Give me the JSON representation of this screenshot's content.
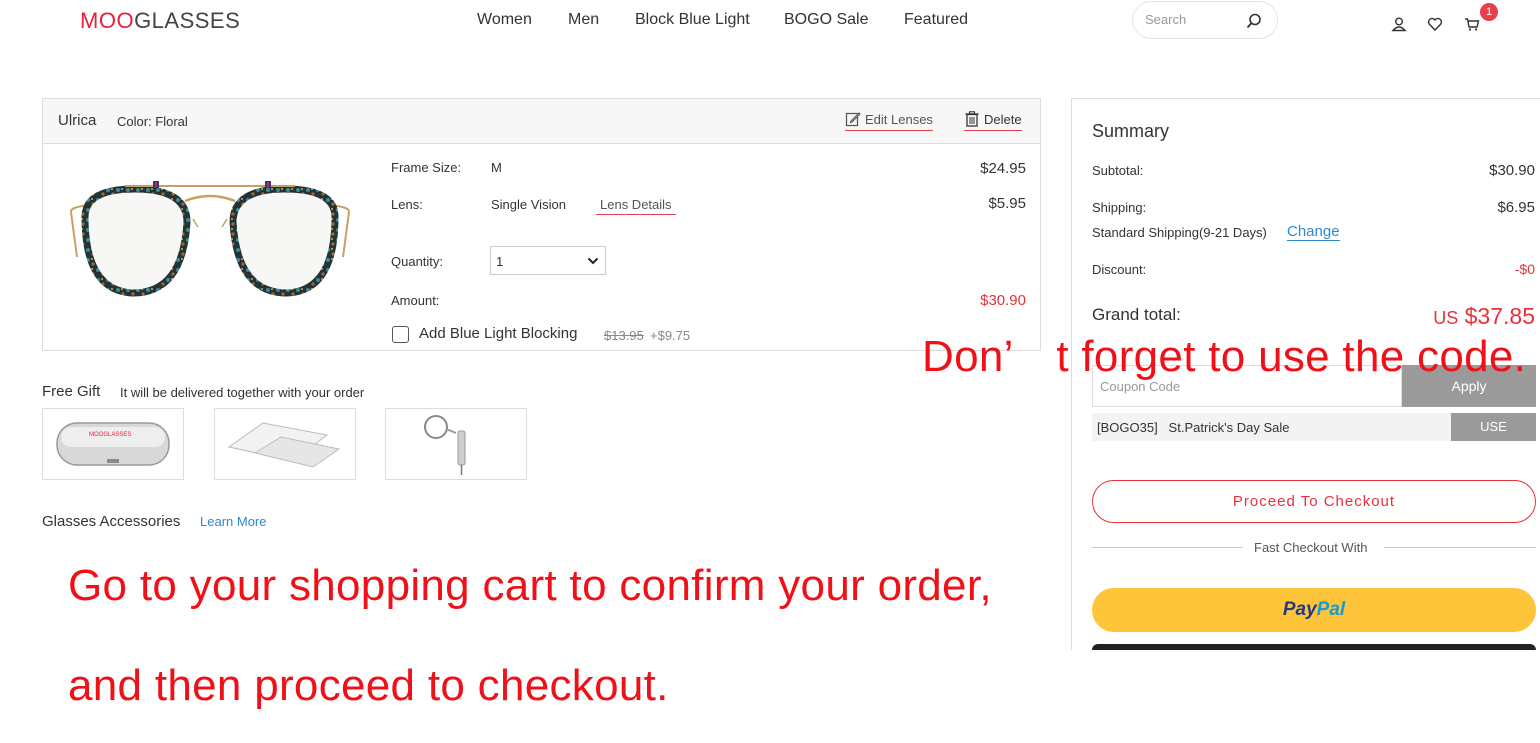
{
  "header": {
    "logo_part1": "MOO",
    "logo_part2": "GLASSES",
    "nav": [
      "Women",
      "Men",
      "Block Blue Light",
      "BOGO Sale",
      "Featured"
    ],
    "search_placeholder": "Search",
    "cart_count": "1"
  },
  "item": {
    "name": "Ulrica",
    "color": "Color: Floral",
    "edit_lenses": "Edit Lenses",
    "delete": "Delete",
    "frame_size_label": "Frame Size:",
    "frame_size_value": "M",
    "frame_price": "$24.95",
    "lens_label": "Lens:",
    "lens_value": "Single Vision",
    "lens_details": "Lens Details",
    "lens_price": "$5.95",
    "quantity_label": "Quantity:",
    "quantity_value": "1",
    "amount_label": "Amount:",
    "amount_value": "$30.90",
    "add_blue_light": "Add Blue Light Blocking",
    "blue_light_old_price": "$13.95",
    "blue_light_new_price": "+$9.75"
  },
  "gift": {
    "title": "Free Gift",
    "subtitle": "It will be delivered together with your order",
    "case_brand": "MOOGLASSES"
  },
  "accessories": {
    "title": "Glasses Accessories",
    "learn_more": "Learn More"
  },
  "overlay": {
    "code_hint": "Don’　t forget to use the code.",
    "line1": "Go to your shopping cart to confirm your order,",
    "line2": "and then proceed to checkout."
  },
  "summary": {
    "title": "Summary",
    "subtotal_label": "Subtotal:",
    "subtotal_value": "$30.90",
    "shipping_label": "Shipping:",
    "shipping_value": "$6.95",
    "shipping_method": "Standard Shipping(9-21 Days)",
    "change": "Change",
    "discount_label": "Discount:",
    "discount_value": "-$0",
    "grand_total_label": "Grand total:",
    "grand_total_currency": "US",
    "grand_total_value": "$37.85",
    "coupon_placeholder": "Coupon Code",
    "apply": "Apply",
    "coupon_code": "[BOGO35]",
    "coupon_desc": "St.Patrick's Day Sale",
    "use": "USE",
    "checkout": "Proceed To Checkout",
    "fast_checkout": "Fast Checkout With",
    "paypal_1": "Pay",
    "paypal_2": "Pal"
  },
  "colors": {
    "brand_red": "#e8203b",
    "price_red": "#e8303a",
    "link_blue": "#2a8ad2",
    "paypal_yellow": "#fec43a"
  }
}
